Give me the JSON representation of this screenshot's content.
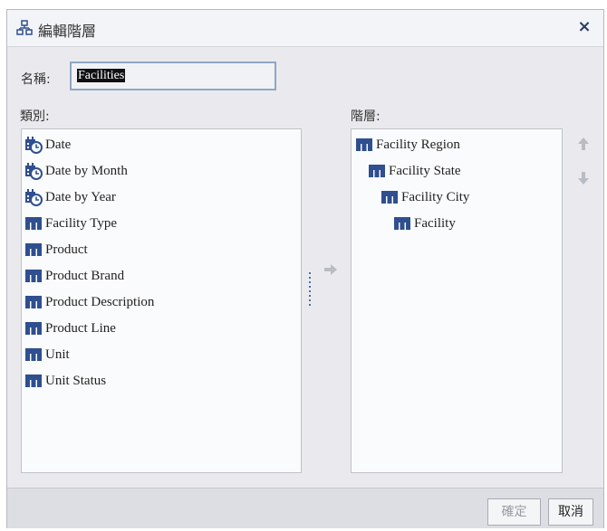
{
  "dialog": {
    "title": "編輯階層",
    "close_label": "×"
  },
  "name_field": {
    "label": "名稱:",
    "value": "Facilities"
  },
  "categories": {
    "label": "類別:",
    "items": [
      {
        "label": "Date",
        "icon": "calendar-clock-icon"
      },
      {
        "label": "Date by Month",
        "icon": "calendar-clock-icon"
      },
      {
        "label": "Date by Year",
        "icon": "calendar-clock-icon"
      },
      {
        "label": "Facility Type",
        "icon": "category-icon"
      },
      {
        "label": "Product",
        "icon": "category-icon"
      },
      {
        "label": "Product Brand",
        "icon": "category-icon"
      },
      {
        "label": "Product Description",
        "icon": "category-icon"
      },
      {
        "label": "Product Line",
        "icon": "category-icon"
      },
      {
        "label": "Unit",
        "icon": "category-icon"
      },
      {
        "label": "Unit Status",
        "icon": "category-icon"
      }
    ]
  },
  "hierarchy": {
    "label": "階層:",
    "items": [
      {
        "label": "Facility Region",
        "level": 0,
        "icon": "category-icon"
      },
      {
        "label": "Facility State",
        "level": 1,
        "icon": "category-icon"
      },
      {
        "label": "Facility City",
        "level": 2,
        "icon": "category-icon"
      },
      {
        "label": "Facility",
        "level": 3,
        "icon": "category-icon"
      }
    ]
  },
  "footer": {
    "ok_label": "確定",
    "cancel_label": "取消"
  },
  "colors": {
    "category_icon": "#2f4f8f",
    "arrow_disabled": "#b9bcc3",
    "close": "#2a3d67"
  }
}
